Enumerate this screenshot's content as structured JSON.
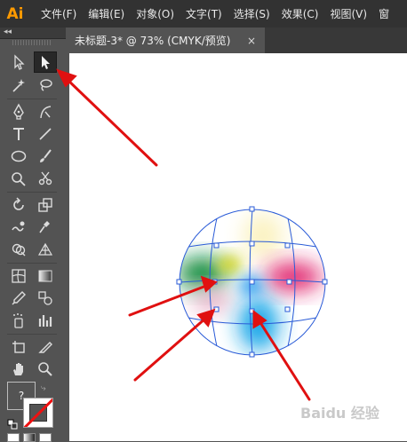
{
  "app": {
    "logo": "Ai"
  },
  "menu": {
    "items": [
      "文件(F)",
      "编辑(E)",
      "对象(O)",
      "文字(T)",
      "选择(S)",
      "效果(C)",
      "视图(V)",
      "窗"
    ]
  },
  "document": {
    "tab_title": "未标题-3* @ 73% (CMYK/预览)",
    "close_glyph": "×"
  },
  "toolbar": {
    "collapse_glyph": "◂◂",
    "tools": [
      "selection-tool",
      "direct-selection-tool",
      "magic-wand-tool",
      "lasso-tool",
      "pen-tool",
      "curvature-tool",
      "type-tool",
      "line-segment-tool",
      "ellipse-tool",
      "paintbrush-tool",
      "shaper-tool",
      "scissors-tool",
      "rotate-tool",
      "scale-tool",
      "warp-tool",
      "puppet-warp-tool",
      "shape-builder-tool",
      "perspective-grid-tool",
      "mesh-tool",
      "gradient-tool",
      "eyedropper-tool",
      "blend-tool",
      "symbol-sprayer-tool",
      "column-graph-tool",
      "artboard-tool",
      "slice-tool",
      "hand-tool",
      "zoom-tool"
    ],
    "active_tool": "direct-selection-tool",
    "fill_box_label": "?"
  },
  "watermark": {
    "text": "Baidu 经验"
  },
  "colors": {
    "accent_logo": "#ff9a00",
    "arrow": "#e01010",
    "mesh_line": "#2a5bd7"
  }
}
